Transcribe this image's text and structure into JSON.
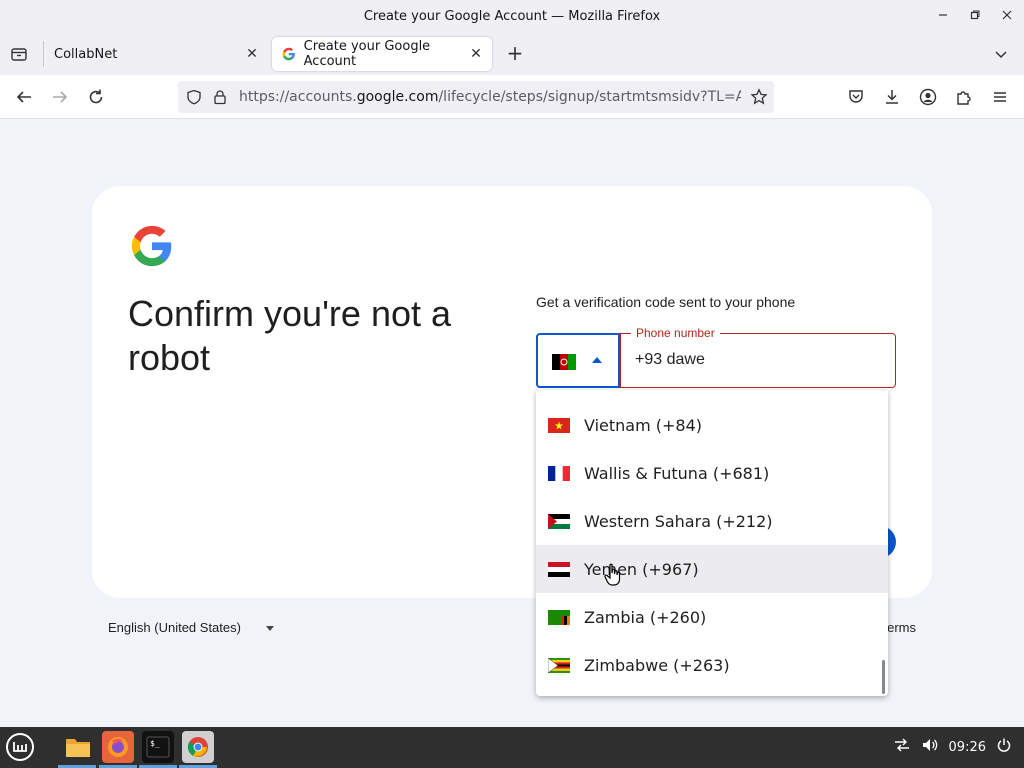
{
  "window": {
    "title": "Create your Google Account — Mozilla Firefox",
    "controls": [
      "minimize-icon",
      "restore-icon",
      "close-icon"
    ]
  },
  "tabs": [
    {
      "label": "CollabNet",
      "active": false
    },
    {
      "label": "Create your Google Account",
      "active": true
    }
  ],
  "navbar": {
    "url_prefix": "https://accounts.",
    "url_domain": "google.com",
    "url_path": "/lifecycle/steps/signup/startmtsmsidv?TL=AE--Llz2t"
  },
  "page": {
    "heading": "Confirm you're not a robot",
    "subtitle": "Get a verification code sent to your phone",
    "country_flag": "af-flag-icon",
    "phone_label": "Phone number",
    "phone_value": "+93 dawe",
    "language": "English (United States)",
    "terms": "erms"
  },
  "dropdown": {
    "options": [
      {
        "label": "Vietnam (+84)",
        "flag": "vn"
      },
      {
        "label": "Wallis & Futuna (+681)",
        "flag": "fr"
      },
      {
        "label": "Western Sahara (+212)",
        "flag": "eh"
      },
      {
        "label": "Yemen (+967)",
        "flag": "ye",
        "hovered": true
      },
      {
        "label": "Zambia (+260)",
        "flag": "zm"
      },
      {
        "label": "Zimbabwe (+263)",
        "flag": "zw"
      }
    ]
  },
  "taskbar": {
    "clock": "09:26"
  },
  "colors": {
    "accent": "#0b57d0",
    "error": "#b3261e",
    "page_bg": "#f0f4f9"
  }
}
